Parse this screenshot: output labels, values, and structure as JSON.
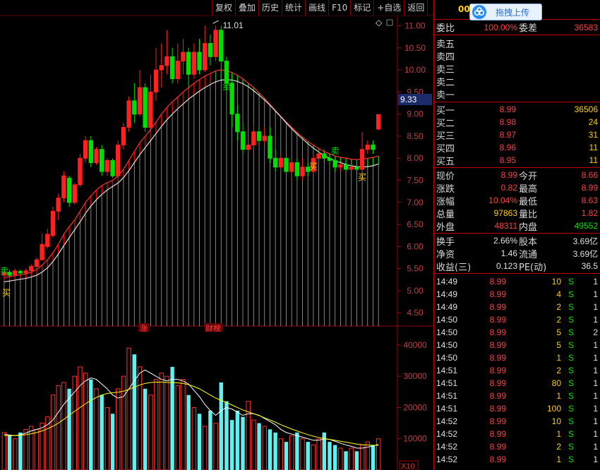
{
  "toolbar": {
    "buttons": [
      "复权",
      "叠加",
      "历史",
      "统计",
      "画线",
      "F10",
      "标记",
      "+自选",
      "返回"
    ]
  },
  "price_chart": {
    "y_ticks": [
      "11.00",
      "10.50",
      "10.00",
      "9.50",
      "9.00",
      "8.50",
      "8.00",
      "7.50",
      "7.00",
      "6.50",
      "6.00",
      "5.50",
      "5.00",
      "4.50"
    ],
    "current_price_tag": "9.33",
    "high_label": "11.01",
    "signal_buy": "买",
    "signal_sell": "卖",
    "bottom_markers": [
      "涨",
      "财榜"
    ],
    "diamond": "◇"
  },
  "volume_chart": {
    "y_ticks": [
      "40000",
      "30000",
      "20000",
      "10000"
    ],
    "unit": "X10"
  },
  "side": {
    "code": "00",
    "upload_label": "拖拽上传",
    "weibi_label": "委比",
    "weibi_value": "100.00%",
    "weicha_label": "委差",
    "weicha_value": "36583",
    "sell_levels": [
      "卖五",
      "卖四",
      "卖三",
      "卖二",
      "卖一"
    ],
    "buy_levels": [
      {
        "label": "买一",
        "price": "8.99",
        "vol": "36506"
      },
      {
        "label": "买二",
        "price": "8.98",
        "vol": "24"
      },
      {
        "label": "买三",
        "price": "8.97",
        "vol": "31"
      },
      {
        "label": "买四",
        "price": "8.96",
        "vol": "11"
      },
      {
        "label": "买五",
        "price": "8.95",
        "vol": "11"
      }
    ],
    "stats": [
      {
        "l1": "现价",
        "v1": "8.99",
        "c1": "red",
        "l2": "今开",
        "v2": "8.66",
        "c2": "red"
      },
      {
        "l1": "涨跌",
        "v1": "0.82",
        "c1": "red",
        "l2": "最高",
        "v2": "8.99",
        "c2": "red"
      },
      {
        "l1": "涨幅",
        "v1": "10.04%",
        "c1": "red",
        "l2": "最低",
        "v2": "8.63",
        "c2": "red"
      },
      {
        "l1": "总量",
        "v1": "97863",
        "c1": "yellow",
        "l2": "量比",
        "v2": "1.82",
        "c2": "red"
      },
      {
        "l1": "外盘",
        "v1": "48311",
        "c1": "red",
        "l2": "内盘",
        "v2": "49552",
        "c2": "green"
      }
    ],
    "stats2": [
      {
        "l1": "换手",
        "v1": "2.66%",
        "c1": "white",
        "l2": "股本",
        "v2": "3.69亿",
        "c2": "white"
      },
      {
        "l1": "净资",
        "v1": "1.46",
        "c1": "white",
        "l2": "流通",
        "v2": "3.69亿",
        "c2": "white"
      },
      {
        "l1": "收益(三)",
        "v1": "0.123",
        "c1": "white",
        "l2": "PE(动)",
        "v2": "36.5",
        "c2": "white"
      }
    ],
    "ticks": [
      {
        "t": "14:49",
        "p": "8.99",
        "v": "10",
        "f": "S",
        "n": "1"
      },
      {
        "t": "14:49",
        "p": "8.99",
        "v": "4",
        "f": "S",
        "n": "1"
      },
      {
        "t": "14:49",
        "p": "8.99",
        "v": "2",
        "f": "S",
        "n": "1"
      },
      {
        "t": "14:50",
        "p": "8.99",
        "v": "2",
        "f": "S",
        "n": "1"
      },
      {
        "t": "14:50",
        "p": "8.99",
        "v": "5",
        "f": "S",
        "n": "2"
      },
      {
        "t": "14:50",
        "p": "8.99",
        "v": "5",
        "f": "S",
        "n": "1"
      },
      {
        "t": "14:50",
        "p": "8.99",
        "v": "1",
        "f": "S",
        "n": "1"
      },
      {
        "t": "14:51",
        "p": "8.99",
        "v": "2",
        "f": "S",
        "n": "1"
      },
      {
        "t": "14:51",
        "p": "8.99",
        "v": "80",
        "f": "S",
        "n": "1"
      },
      {
        "t": "14:51",
        "p": "8.99",
        "v": "1",
        "f": "S",
        "n": "1"
      },
      {
        "t": "14:51",
        "p": "8.99",
        "v": "100",
        "f": "S",
        "n": "1"
      },
      {
        "t": "14:52",
        "p": "8.99",
        "v": "10",
        "f": "S",
        "n": "1"
      },
      {
        "t": "14:52",
        "p": "8.99",
        "v": "1",
        "f": "S",
        "n": "1"
      },
      {
        "t": "14:52",
        "p": "8.99",
        "v": "2",
        "f": "S",
        "n": "1"
      },
      {
        "t": "14:52",
        "p": "8.99",
        "v": "1",
        "f": "S",
        "n": "1"
      }
    ]
  },
  "chart_data": {
    "type": "candlestick",
    "ylim": [
      4.2,
      11.2
    ],
    "candles": [
      [
        5.35,
        5.42,
        5.3,
        5.45
      ],
      [
        5.42,
        5.35,
        5.3,
        5.47
      ],
      [
        5.36,
        5.45,
        5.33,
        5.5
      ],
      [
        5.44,
        5.4,
        5.36,
        5.48
      ],
      [
        5.4,
        5.45,
        5.38,
        5.5
      ],
      [
        5.45,
        5.55,
        5.42,
        5.6
      ],
      [
        5.55,
        5.7,
        5.5,
        5.75
      ],
      [
        5.7,
        6.05,
        5.68,
        6.3
      ],
      [
        6.0,
        6.28,
        5.95,
        6.4
      ],
      [
        6.25,
        6.8,
        6.2,
        6.9
      ],
      [
        6.8,
        7.1,
        6.6,
        7.2
      ],
      [
        7.1,
        7.6,
        7.0,
        7.7
      ],
      [
        7.55,
        7.0,
        6.9,
        7.6
      ],
      [
        7.0,
        7.4,
        6.95,
        7.45
      ],
      [
        7.4,
        8.0,
        7.35,
        8.1
      ],
      [
        8.0,
        8.4,
        7.9,
        8.5
      ],
      [
        8.4,
        7.9,
        7.8,
        8.5
      ],
      [
        7.9,
        8.2,
        7.85,
        8.25
      ],
      [
        8.2,
        7.7,
        7.6,
        8.3
      ],
      [
        7.7,
        7.95,
        7.6,
        8.0
      ],
      [
        7.95,
        7.6,
        7.55,
        8.0
      ],
      [
        7.6,
        8.3,
        7.6,
        8.4
      ],
      [
        8.3,
        8.7,
        8.2,
        8.8
      ],
      [
        8.7,
        9.3,
        8.6,
        9.4
      ],
      [
        9.3,
        9.0,
        8.8,
        9.7
      ],
      [
        9.0,
        9.6,
        8.95,
        10.0
      ],
      [
        9.6,
        8.7,
        8.6,
        9.7
      ],
      [
        8.7,
        9.5,
        8.6,
        9.9
      ],
      [
        9.5,
        10.0,
        9.3,
        10.5
      ],
      [
        10.0,
        10.1,
        9.6,
        10.6
      ],
      [
        10.1,
        10.3,
        9.9,
        10.9
      ],
      [
        10.3,
        9.8,
        9.7,
        10.5
      ],
      [
        9.8,
        10.2,
        9.7,
        10.6
      ],
      [
        10.2,
        10.4,
        9.9,
        10.7
      ],
      [
        10.4,
        9.9,
        9.6,
        10.5
      ],
      [
        9.9,
        10.4,
        9.8,
        10.6
      ],
      [
        10.4,
        10.0,
        9.9,
        10.7
      ],
      [
        10.0,
        10.6,
        9.95,
        11.0
      ],
      [
        10.6,
        10.3,
        10.1,
        10.8
      ],
      [
        10.3,
        10.9,
        10.2,
        11.01
      ],
      [
        10.9,
        10.2,
        10.0,
        11.0
      ],
      [
        10.2,
        9.7,
        9.5,
        10.3
      ],
      [
        9.7,
        9.0,
        8.7,
        9.9
      ],
      [
        9.0,
        8.6,
        8.4,
        9.2
      ],
      [
        8.6,
        8.2,
        8.1,
        8.8
      ],
      [
        8.2,
        8.3,
        8.1,
        8.5
      ],
      [
        8.3,
        8.6,
        8.2,
        8.8
      ],
      [
        8.6,
        8.4,
        8.3,
        8.7
      ],
      [
        8.4,
        8.5,
        8.3,
        8.7
      ],
      [
        8.5,
        8.0,
        7.9,
        8.7
      ],
      [
        8.0,
        7.8,
        7.7,
        8.2
      ],
      [
        7.8,
        8.0,
        7.7,
        8.1
      ],
      [
        8.0,
        7.7,
        7.6,
        8.1
      ],
      [
        7.7,
        7.9,
        7.5,
        8.0
      ],
      [
        7.9,
        7.6,
        7.5,
        8.0
      ],
      [
        7.6,
        7.8,
        7.5,
        8.0
      ],
      [
        7.8,
        7.7,
        7.6,
        7.9
      ],
      [
        7.7,
        8.0,
        7.65,
        8.1
      ],
      [
        8.0,
        8.1,
        7.9,
        8.2
      ],
      [
        8.1,
        8.0,
        7.9,
        8.2
      ],
      [
        8.0,
        7.95,
        7.85,
        8.1
      ],
      [
        7.95,
        7.8,
        7.7,
        8.0
      ],
      [
        7.8,
        7.85,
        7.7,
        7.9
      ],
      [
        7.85,
        7.75,
        7.7,
        7.9
      ],
      [
        7.75,
        7.8,
        7.7,
        7.85
      ],
      [
        7.8,
        7.75,
        7.65,
        7.85
      ],
      [
        7.75,
        8.2,
        7.7,
        8.6
      ],
      [
        8.2,
        8.3,
        8.1,
        8.4
      ],
      [
        8.3,
        8.2,
        8.1,
        8.4
      ],
      [
        8.66,
        8.99,
        8.63,
        8.99
      ]
    ],
    "ma_fast": [
      5.3,
      5.32,
      5.34,
      5.36,
      5.38,
      5.42,
      5.48,
      5.58,
      5.7,
      5.86,
      6.05,
      6.28,
      6.45,
      6.6,
      6.8,
      7.0,
      7.15,
      7.28,
      7.38,
      7.45,
      7.5,
      7.6,
      7.75,
      7.95,
      8.15,
      8.35,
      8.5,
      8.65,
      8.82,
      9.0,
      9.15,
      9.28,
      9.38,
      9.5,
      9.6,
      9.7,
      9.78,
      9.86,
      9.92,
      9.98,
      10.0,
      9.98,
      9.94,
      9.88,
      9.8,
      9.7,
      9.6,
      9.48,
      9.36,
      9.22,
      9.08,
      8.95,
      8.82,
      8.7,
      8.58,
      8.48,
      8.38,
      8.3,
      8.22,
      8.15,
      8.1,
      8.05,
      8.02,
      8.0,
      7.98,
      7.97,
      7.98,
      8.0,
      8.02,
      8.05
    ],
    "ma_slow": [
      5.2,
      5.22,
      5.24,
      5.26,
      5.28,
      5.31,
      5.35,
      5.42,
      5.52,
      5.66,
      5.83,
      6.02,
      6.2,
      6.38,
      6.56,
      6.75,
      6.92,
      7.06,
      7.18,
      7.28,
      7.36,
      7.44,
      7.56,
      7.72,
      7.9,
      8.08,
      8.24,
      8.4,
      8.56,
      8.72,
      8.87,
      9.0,
      9.12,
      9.23,
      9.34,
      9.43,
      9.52,
      9.6,
      9.67,
      9.73,
      9.77,
      9.78,
      9.77,
      9.74,
      9.69,
      9.62,
      9.53,
      9.43,
      9.32,
      9.2,
      9.07,
      8.94,
      8.8,
      8.67,
      8.55,
      8.44,
      8.33,
      8.23,
      8.14,
      8.06,
      8.0,
      7.94,
      7.9,
      7.86,
      7.83,
      7.81,
      7.8,
      7.81,
      7.83,
      7.87
    ],
    "volumes": [
      12000,
      11000,
      10000,
      12000,
      13000,
      14000,
      13000,
      15000,
      17000,
      24000,
      27000,
      28000,
      26000,
      30000,
      33000,
      31000,
      29000,
      26000,
      24000,
      20000,
      18000,
      26000,
      30000,
      39000,
      37000,
      33000,
      26000,
      24000,
      29000,
      31000,
      30000,
      33000,
      27000,
      29000,
      24000,
      20000,
      18000,
      14000,
      19000,
      15000,
      28000,
      22000,
      16000,
      19000,
      17000,
      22000,
      16000,
      15000,
      14000,
      13000,
      12000,
      10000,
      9000,
      11000,
      12000,
      10000,
      9000,
      8000,
      10000,
      12000,
      9000,
      8000,
      7000,
      6000,
      7000,
      6000,
      8000,
      9000,
      8000,
      10000
    ],
    "vol_ma_fast": [
      11500,
      11200,
      11000,
      11300,
      11800,
      12500,
      13000,
      13500,
      14500,
      16000,
      18500,
      21000,
      23000,
      25000,
      27000,
      28500,
      29500,
      29000,
      27500,
      26000,
      24000,
      23000,
      23500,
      26000,
      28500,
      31000,
      32000,
      31000,
      30000,
      29000,
      28500,
      29000,
      29000,
      28500,
      27500,
      25500,
      23500,
      21000,
      19000,
      17500,
      19000,
      20000,
      19500,
      18500,
      17500,
      18000,
      18000,
      17500,
      16500,
      15500,
      14500,
      13000,
      12000,
      11500,
      11000,
      10500,
      10000,
      9500,
      9500,
      10000,
      9800,
      9200,
      8600,
      8000,
      7600,
      7000,
      7000,
      7300,
      7700,
      8200
    ],
    "vol_ma_slow": [
      11000,
      11000,
      11000,
      11100,
      11300,
      11600,
      12000,
      12500,
      13200,
      14000,
      15000,
      16200,
      17500,
      18800,
      20000,
      21200,
      22300,
      23200,
      24000,
      24500,
      24700,
      24900,
      25200,
      25800,
      26500,
      27200,
      27700,
      28000,
      28100,
      28100,
      28000,
      28000,
      27900,
      27700,
      27300,
      26700,
      26000,
      25000,
      24000,
      23000,
      22300,
      21600,
      20800,
      20000,
      19200,
      18600,
      18000,
      17400,
      16700,
      16000,
      15300,
      14500,
      13800,
      13100,
      12500,
      11900,
      11300,
      10800,
      10400,
      10100,
      9800,
      9500,
      9200,
      8900,
      8600,
      8300,
      8100,
      8000,
      7900,
      7900
    ]
  }
}
